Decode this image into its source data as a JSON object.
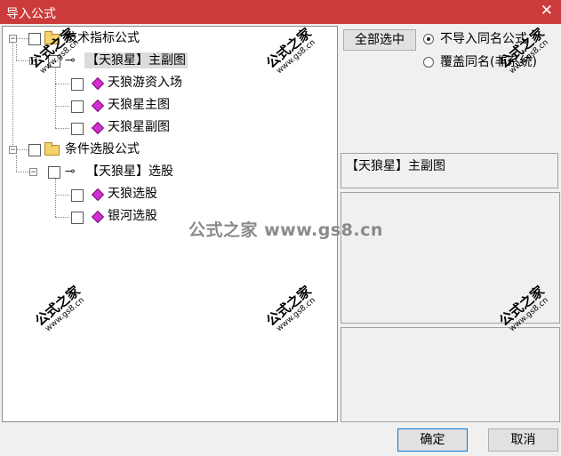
{
  "window": {
    "title": "导入公式",
    "close_glyph": "✕"
  },
  "tree": {
    "groups": [
      {
        "label": "技术指标公式",
        "sub": {
          "label": "【天狼星】主副图",
          "items": [
            "天狼游资入场",
            "天狼星主图",
            "天狼星副图"
          ]
        }
      },
      {
        "label": "条件选股公式",
        "sub": {
          "label": "【天狼星】选股",
          "items": [
            "天狼选股",
            "银河选股"
          ]
        }
      }
    ],
    "expander_glyph": "−",
    "key_glyph": "⊸"
  },
  "right": {
    "select_all_label": "全部选中",
    "radio_options": [
      {
        "label": "不导入同名公式",
        "checked": true
      },
      {
        "label": "覆盖同名(非系统)",
        "checked": false
      }
    ],
    "info_text": "【天狼星】主副图"
  },
  "buttons": {
    "ok": "确定",
    "cancel": "取消"
  },
  "watermark": {
    "chinese": "公式之家",
    "url": "www.gs8.cn",
    "center": "公式之家 www.gs8.cn"
  }
}
